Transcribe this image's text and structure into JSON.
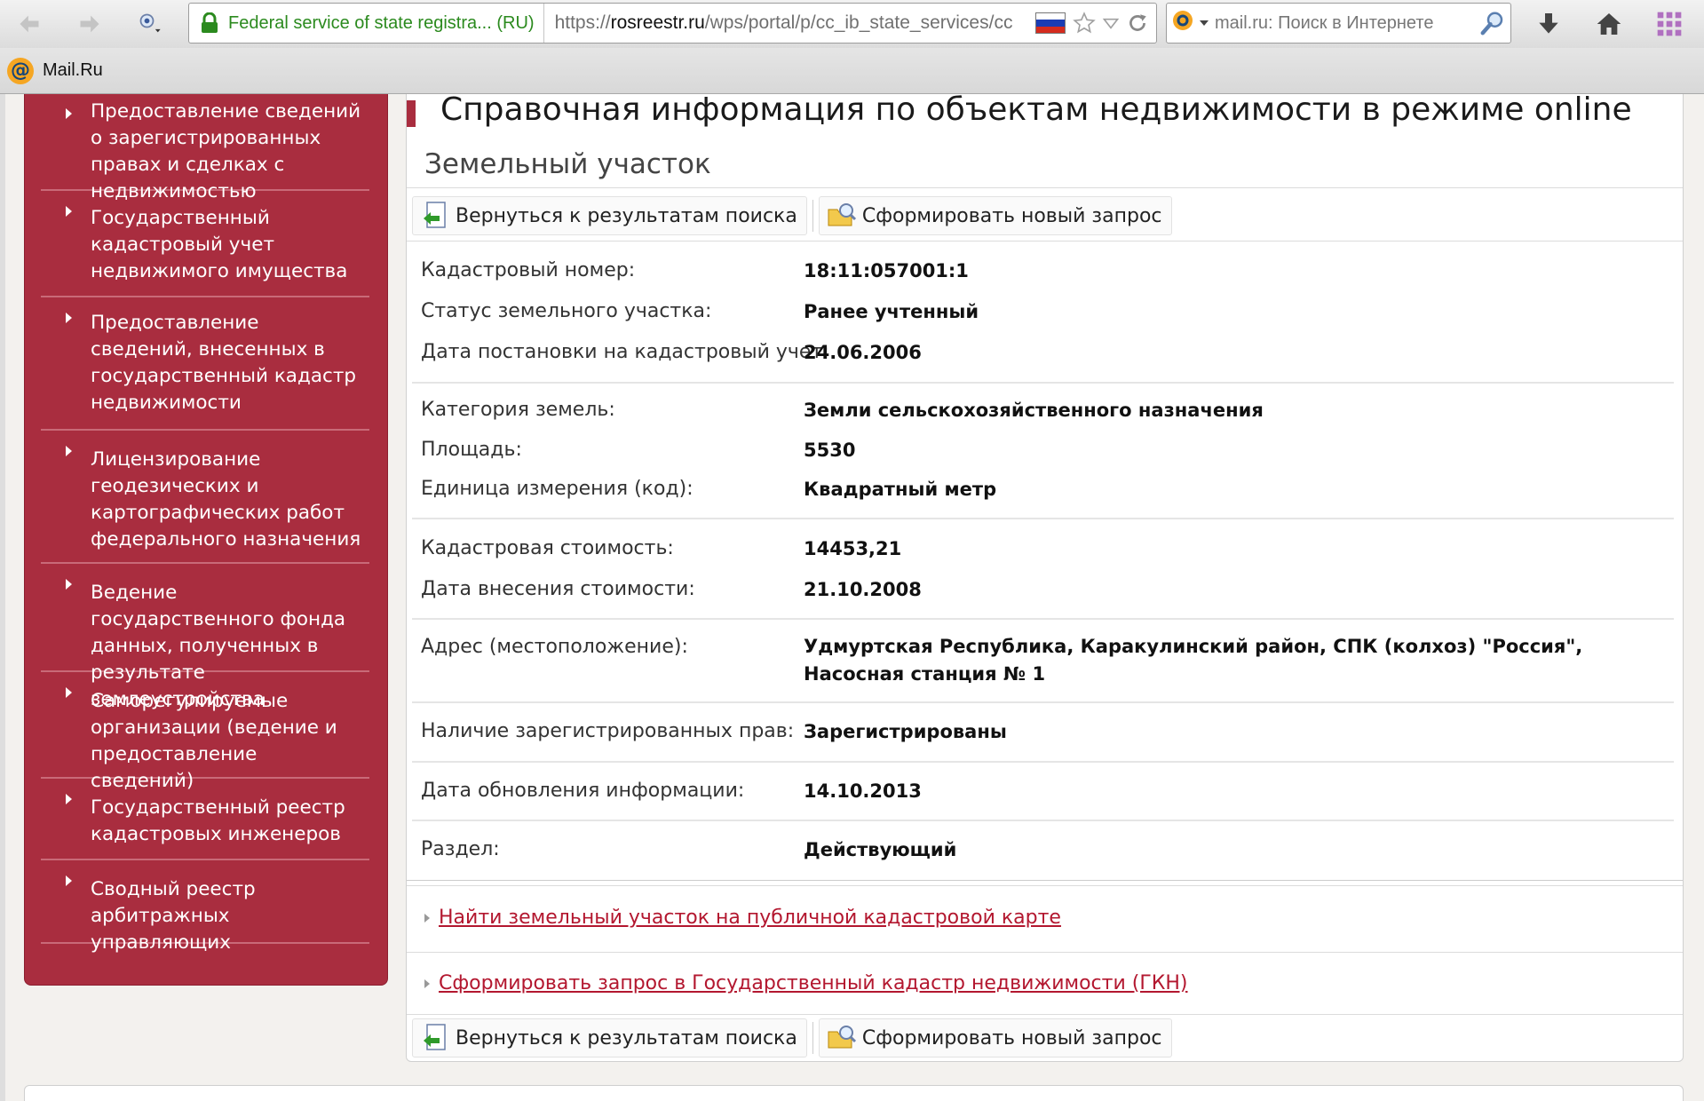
{
  "browser": {
    "identity": "Federal service of state registra... (RU)",
    "url_prefix": "https://",
    "url_host": "rosreestr.ru",
    "url_path": "/wps/portal/p/cc_ib_state_services/cc",
    "search_placeholder": "mail.ru: Поиск в Интернете",
    "bookmark_label": "Mail.Ru",
    "bookmark_icon_letter": "@"
  },
  "sidebar": {
    "items": [
      {
        "label": "Предоставление сведений о зарегистрированных правах и сделках с недвижимостью"
      },
      {
        "label": "Государственный кадастровый учет недвижимого имущества"
      },
      {
        "label": "Предоставление сведений, внесенных в государственный кадастр недвижимости"
      },
      {
        "label": "Лицензирование геодезических и картографических работ федерального назначения"
      },
      {
        "label": "Ведение государственного фонда данных, полученных в результате землеустройства"
      },
      {
        "label": "Саморегулируемые организации (ведение и предоставление сведений)"
      },
      {
        "label": "Государственный реестр кадастровых инженеров"
      },
      {
        "label": "Сводный реестр арбитражных управляющих"
      }
    ]
  },
  "main": {
    "title": "Справочная информация по объектам недвижимости в режиме online",
    "section_title": "Земельный участок",
    "back_button": "Вернуться к результатам поиска",
    "new_request_button": "Сформировать новый запрос",
    "fields": [
      {
        "label": "Кадастровый номер:",
        "value": "18:11:057001:1"
      },
      {
        "label": "Статус земельного участка:",
        "value": "Ранее учтенный"
      },
      {
        "label": "Дата постановки на кадастровый учет:",
        "value": "24.06.2006"
      },
      {
        "label": "Категория земель:",
        "value": "Земли сельскохозяйственного назначения"
      },
      {
        "label": "Площадь:",
        "value": "5530"
      },
      {
        "label": "Единица измерения (код):",
        "value": "Квадратный метр"
      },
      {
        "label": "Кадастровая стоимость:",
        "value": "14453,21"
      },
      {
        "label": "Дата внесения стоимости:",
        "value": "21.10.2008"
      },
      {
        "label": "Адрес (местоположение):",
        "value": "Удмуртская Республика, Каракулинский район, СПК (колхоз) \"Россия\", Насосная станция № 1"
      },
      {
        "label": "Наличие зарегистрированных прав:",
        "value": "Зарегистрированы"
      },
      {
        "label": "Дата обновления информации:",
        "value": "14.10.2013"
      },
      {
        "label": "Раздел:",
        "value": "Действующий"
      }
    ],
    "links": [
      {
        "label": "Найти земельный участок на публичной кадастровой карте"
      },
      {
        "label": "Сформировать запрос в Государственный кадастр недвижимости (ГКН)"
      }
    ]
  },
  "colors": {
    "sidebar": "#a92d3f",
    "link": "#b3172f",
    "identity_green": "#2b8a1e"
  }
}
